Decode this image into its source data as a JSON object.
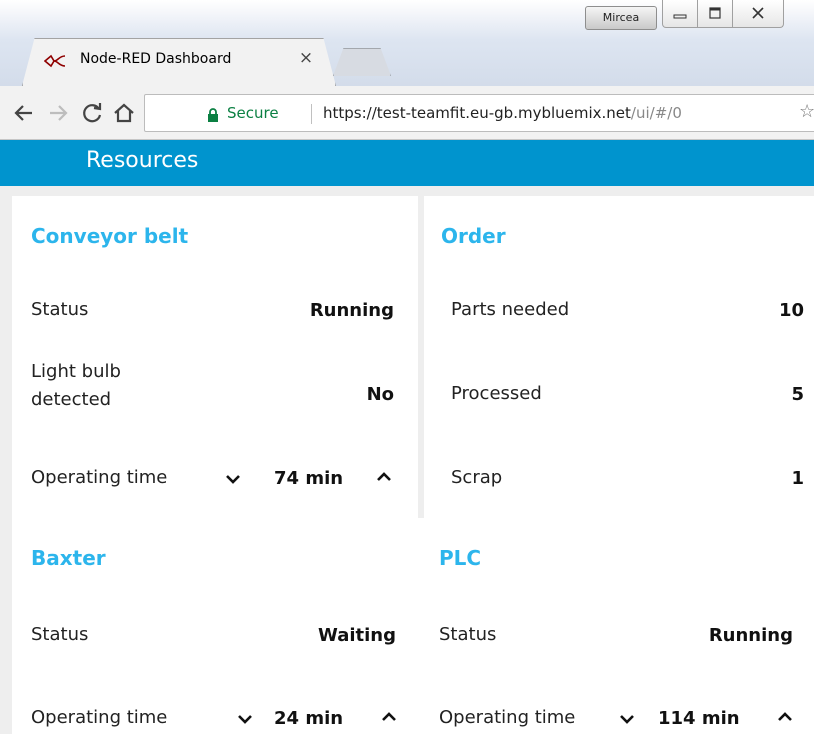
{
  "browser": {
    "tab_title": "Node-RED Dashboard",
    "tab_close": "×",
    "user_badge": "Mircea",
    "window_buttons": {
      "minimize": "–",
      "maximize": "□",
      "close": "✕"
    },
    "secure_label": "Secure",
    "url_host": "https://test-teamfit.eu-gb.mybluemix.net",
    "url_path": "/ui/#/0",
    "icons": [
      "back-icon",
      "forward-icon",
      "reload-icon",
      "home-icon",
      "lock-icon",
      "star-icon"
    ],
    "accent_secure": "#0b8043"
  },
  "dashboard": {
    "title": "Resources",
    "header_color": "#0094ce",
    "group_title_color": "#2cb5ec",
    "groups": {
      "conveyor": {
        "title": "Conveyor belt",
        "rows": [
          {
            "label": "Status",
            "value": "Running"
          },
          {
            "label": "Light bulb detected",
            "value": "No"
          }
        ],
        "stepper": {
          "label": "Operating time",
          "value": "74 min"
        }
      },
      "order": {
        "title": "Order",
        "rows": [
          {
            "label": "Parts needed",
            "value": "10"
          },
          {
            "label": "Processed",
            "value": "5"
          },
          {
            "label": "Scrap",
            "value": "1"
          }
        ]
      },
      "baxter": {
        "title": "Baxter",
        "rows": [
          {
            "label": "Status",
            "value": "Waiting"
          }
        ],
        "stepper": {
          "label": "Operating time",
          "value": "24 min"
        }
      },
      "plc": {
        "title": "PLC",
        "rows": [
          {
            "label": "Status",
            "value": "Running"
          }
        ],
        "stepper": {
          "label": "Operating time",
          "value": "114 min"
        }
      }
    }
  }
}
